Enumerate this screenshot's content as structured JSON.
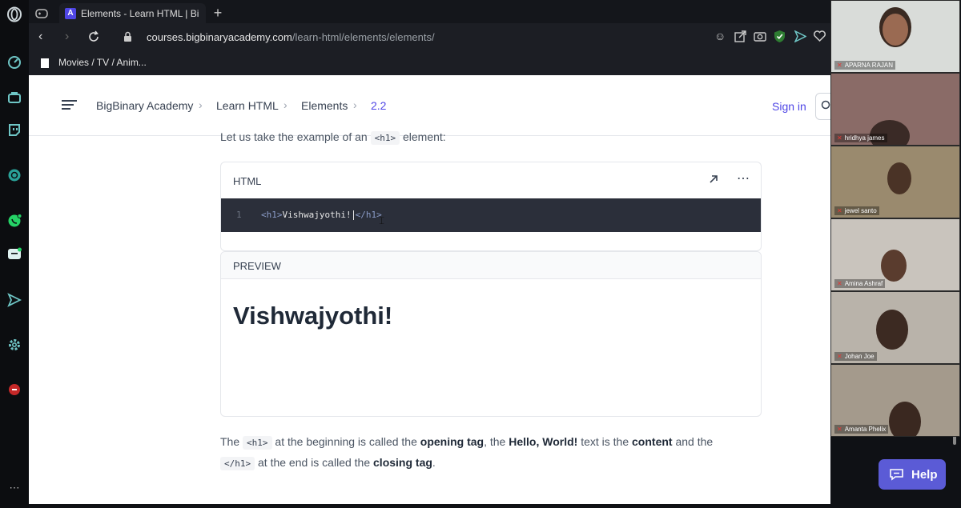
{
  "browser": {
    "tab": {
      "favicon": "A",
      "title": "Elements - Learn HTML | Bi"
    },
    "new_tab": "+",
    "url_domain": "courses.bigbinaryacademy.com",
    "url_path": "/learn-html/elements/elements/",
    "bookmark": "Movies / TV / Anim..."
  },
  "site": {
    "breadcrumbs": [
      "BigBinary Academy",
      "Learn HTML",
      "Elements",
      "2.2"
    ],
    "signin": "Sign in"
  },
  "content": {
    "intro": "Let us take the example of an",
    "intro_code": "<h1>",
    "intro_end": "element:",
    "editor_label": "HTML",
    "line_number": "1",
    "code_open": "<h1>",
    "code_text": "Vishwajyothi!",
    "code_close": "</h1>",
    "preview_label": "PREVIEW",
    "preview_heading": "Vishwajyothi!",
    "para": {
      "t1": "The",
      "c1": "<h1>",
      "t2": "at the beginning is called the",
      "b1": "opening tag",
      "t3": ", the",
      "b2": "Hello, World!",
      "t4": "text is the",
      "b3": "content",
      "t5": "and the",
      "c2": "</h1>",
      "t6": "at the end is called the",
      "b4": "closing tag",
      "t7": "."
    }
  },
  "help": {
    "label": "Help"
  },
  "participants": [
    "APARNA RAJAN",
    "hridhya james",
    "jewel santo",
    "Amina Ashraf",
    "Johan Joe",
    "Amanta Phelix"
  ],
  "colors": {
    "accent": "#4f46e5",
    "help_bg": "#5b5bd6",
    "editor_bg": "#2b2f3a",
    "sidebar_icon": "#6fc6c6"
  }
}
